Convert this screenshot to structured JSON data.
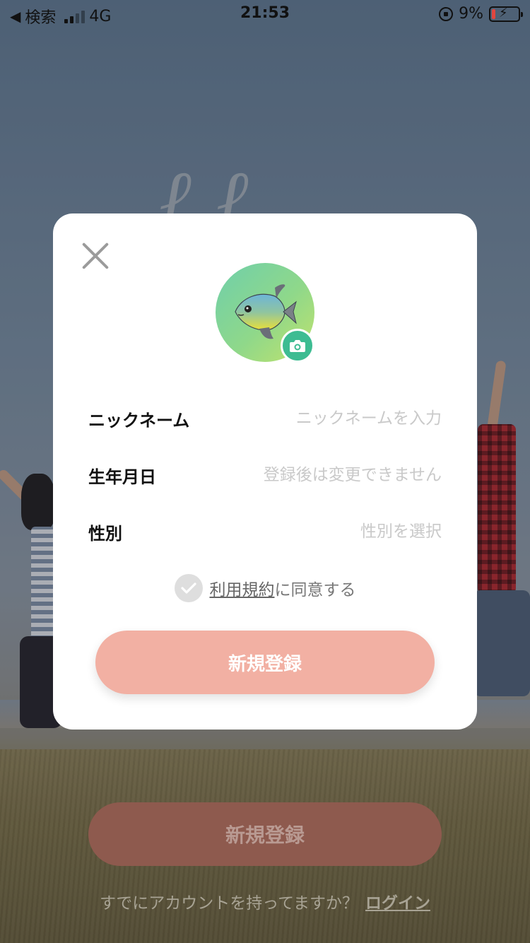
{
  "status_bar": {
    "back_label": "検索",
    "network": "4G",
    "time": "21:53",
    "battery_percent": "9%"
  },
  "background": {
    "register_label": "新規登録",
    "have_account_text": "すでにアカウントを持ってますか？",
    "login_label": "ログイン"
  },
  "modal": {
    "avatar_icon": "fish-emoji",
    "camera_icon": "camera-icon",
    "fields": {
      "nickname": {
        "label": "ニックネーム",
        "placeholder": "ニックネームを入力",
        "value": ""
      },
      "birthday": {
        "label": "生年月日",
        "placeholder": "登録後は変更できません",
        "value": ""
      },
      "gender": {
        "label": "性別",
        "placeholder": "性別を選択",
        "value": ""
      }
    },
    "terms": {
      "link_text": "利用規約",
      "suffix_text": "に同意する",
      "checked": false
    },
    "register_label": "新規登録"
  },
  "colors": {
    "register_button": "#f2b0a3",
    "camera_button": "#3dbc92",
    "avatar_gradient_start": "#6fcfab",
    "avatar_gradient_end": "#c2e36c"
  }
}
